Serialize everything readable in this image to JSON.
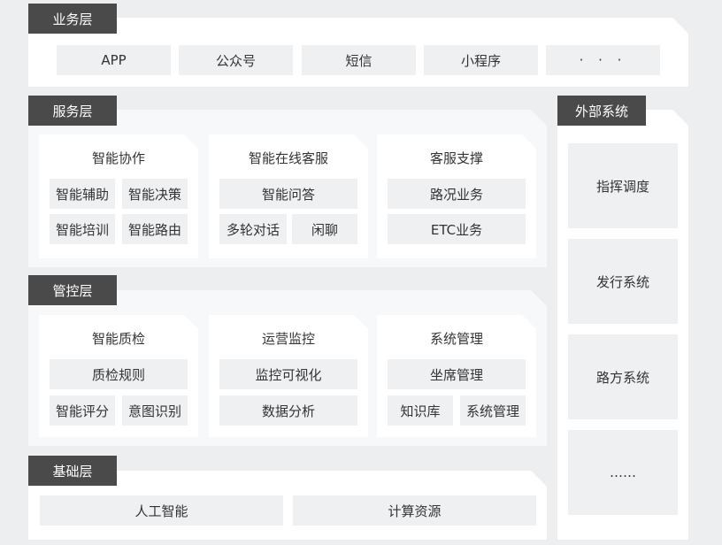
{
  "business": {
    "label": "业务层",
    "items": [
      "APP",
      "公众号",
      "短信",
      "小程序",
      "· · ·"
    ]
  },
  "service": {
    "label": "服务层",
    "cards": [
      {
        "title": "智能协作",
        "items": [
          "智能辅助",
          "智能决策",
          "智能培训",
          "智能路由"
        ]
      },
      {
        "title": "智能在线客服",
        "items": [
          "智能问答",
          "多轮对话",
          "闲聊"
        ]
      },
      {
        "title": "客服支撑",
        "items": [
          "路况业务",
          "ETC业务"
        ]
      }
    ]
  },
  "control": {
    "label": "管控层",
    "cards": [
      {
        "title": "智能质检",
        "items": [
          "质检规则",
          "智能评分",
          "意图识别"
        ]
      },
      {
        "title": "运营监控",
        "items": [
          "监控可视化",
          "数据分析"
        ]
      },
      {
        "title": "系统管理",
        "items": [
          "坐席管理",
          "知识库",
          "系统管理"
        ]
      }
    ]
  },
  "foundation": {
    "label": "基础层",
    "items": [
      "人工智能",
      "计算资源"
    ]
  },
  "external": {
    "label": "外部系统",
    "items": [
      "指挥调度",
      "发行系统",
      "路方系统",
      "……"
    ]
  }
}
